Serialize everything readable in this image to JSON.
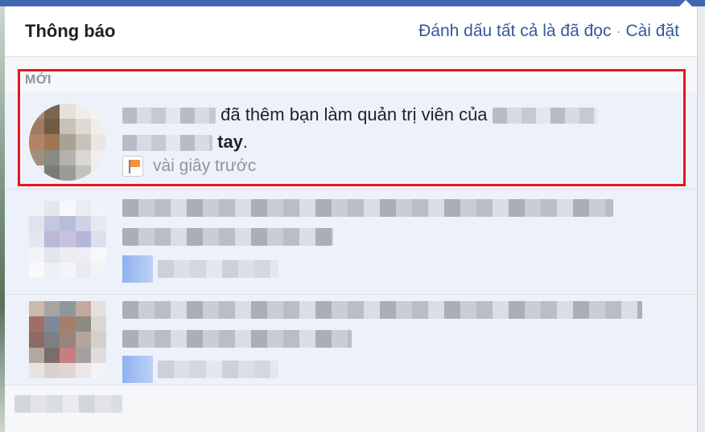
{
  "header": {
    "title": "Thông báo",
    "mark_all_read": "Đánh dấu tất cả là đã đọc",
    "separator": "·",
    "settings": "Cài đặt"
  },
  "section": {
    "new_label": "MỚI"
  },
  "notifications": [
    {
      "action_text": "đã thêm bạn làm quản trị viên của",
      "end_text": "tay",
      "period": ".",
      "time": "vài giây trước",
      "icon": "page-flag-icon",
      "avatar_colors": [
        "#9f8c7e",
        "#7a6650",
        "#e6e1dc",
        "#efedea",
        "#f5f4f2",
        "#a07a60",
        "#6f5a42",
        "#c9c1b8",
        "#dfdad4",
        "#f0eeeb",
        "#b28366",
        "#a07554",
        "#a9a293",
        "#c7c1b8",
        "#e9e7e4",
        "#a38e7e",
        "#8b8a80",
        "#b4b2ab",
        "#d8d7d2",
        "#efeeec",
        "#e8e8e6",
        "#7a7d76",
        "#9a9c95",
        "#c2c3bf",
        "#ecedea"
      ]
    },
    {
      "avatar_colors": [
        "#eef1f6",
        "#e4e7ee",
        "#f7f8fb",
        "#e9ecf2",
        "#f1f3f7",
        "#dfe3ec",
        "#c3c7df",
        "#b9bddc",
        "#d0d3e6",
        "#e7e9f2",
        "#e5e7ef",
        "#bcb9d6",
        "#c7c3de",
        "#b3b8da",
        "#dde0ec",
        "#f3f4f8",
        "#e2e4ee",
        "#ecedf3",
        "#eceef4",
        "#f7f8fa",
        "#f8f9fb",
        "#eef0f5",
        "#f4f5f8",
        "#e9ebf1",
        "#f2f3f7"
      ]
    },
    {
      "avatar_colors": [
        "#c9b9b0",
        "#a7a5a1",
        "#8d9998",
        "#c2a89d",
        "#e3e1e0",
        "#9f6f66",
        "#7e8a9c",
        "#a57e6c",
        "#8d8983",
        "#d9d6d4",
        "#8f6b65",
        "#7e7e84",
        "#9c837a",
        "#b4a49c",
        "#d3cfcc",
        "#b3a7a2",
        "#7c6d6a",
        "#c67e82",
        "#a6a0a0",
        "#e0dcdb",
        "#e6e3e2",
        "#d8d1cf",
        "#e2d4d3",
        "#ebe7e6",
        "#f4f2f2"
      ]
    }
  ],
  "colors": {
    "link": "#365899",
    "highlight_border": "#e4161b",
    "flag": "#f7923a"
  }
}
